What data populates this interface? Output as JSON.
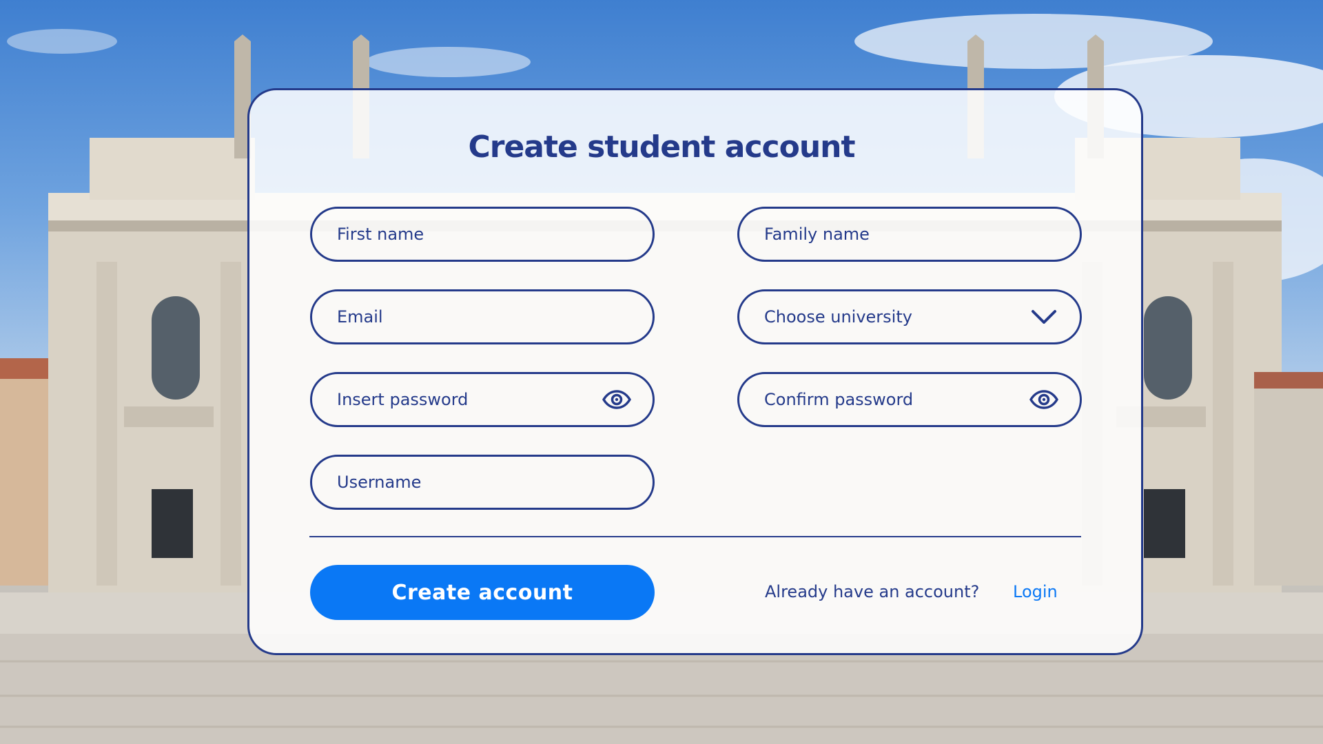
{
  "form": {
    "title": "Create student account",
    "fields": {
      "first_name": {
        "placeholder": "First name"
      },
      "family_name": {
        "placeholder": "Family name"
      },
      "email": {
        "placeholder": "Email"
      },
      "university": {
        "label": "Choose university"
      },
      "password": {
        "placeholder": "Insert password"
      },
      "confirm_password": {
        "placeholder": "Confirm password"
      },
      "username": {
        "placeholder": "Username"
      }
    },
    "submit_label": "Create account",
    "login_prompt": "Already have an account?",
    "login_link": "Login"
  },
  "icons": {
    "university_dropdown": "chevron-down-icon",
    "password_toggle": "eye-icon",
    "confirm_password_toggle": "eye-icon"
  },
  "colors": {
    "primary": "#243a8a",
    "accent": "#0a78f5",
    "button_text": "#ffffff"
  }
}
